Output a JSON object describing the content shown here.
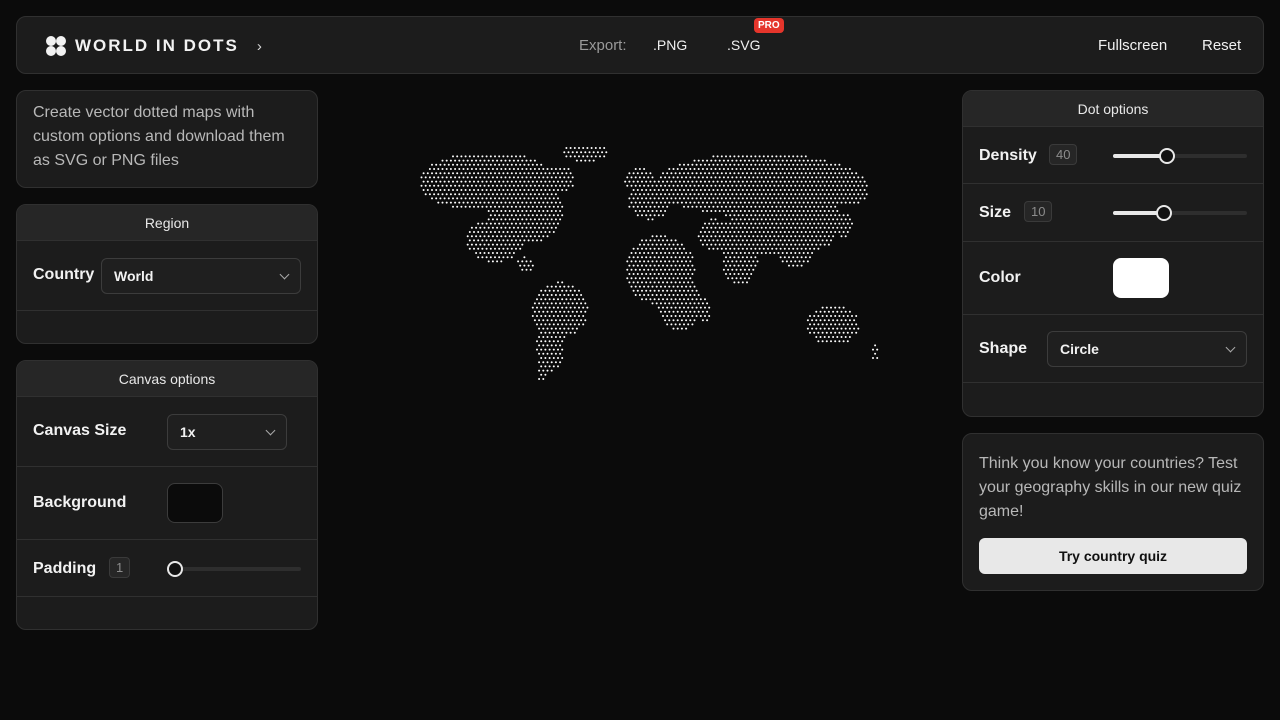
{
  "header": {
    "brand": "WORLD IN DOTS",
    "export_label": "Export:",
    "png_label": ".PNG",
    "svg_label": ".SVG",
    "pro_badge": "PRO",
    "fullscreen_label": "Fullscreen",
    "reset_label": "Reset"
  },
  "intro": {
    "text": "Create vector dotted maps with custom options and download them as SVG or PNG files"
  },
  "region": {
    "title": "Region",
    "country_label": "Country",
    "country_value": "World"
  },
  "canvas": {
    "title": "Canvas options",
    "size_label": "Canvas Size",
    "size_value": "1x",
    "background_label": "Background",
    "background_color": "#0b0b0b",
    "padding_label": "Padding",
    "padding_value": "1",
    "padding_fraction": 0.0
  },
  "dot_options": {
    "title": "Dot options",
    "density_label": "Density",
    "density_value": "40",
    "density_fraction": 0.4,
    "size_label": "Size",
    "size_value": "10",
    "size_fraction": 0.38,
    "color_label": "Color",
    "dot_color": "#ffffff",
    "shape_label": "Shape",
    "shape_value": "Circle"
  },
  "quiz": {
    "text": "Think you know your countries? Test your geography skills in our new quiz game!",
    "button_label": "Try country quiz"
  },
  "icons": {
    "brand": "four-dots-logo-icon",
    "chevron": "chevron-right-icon"
  }
}
